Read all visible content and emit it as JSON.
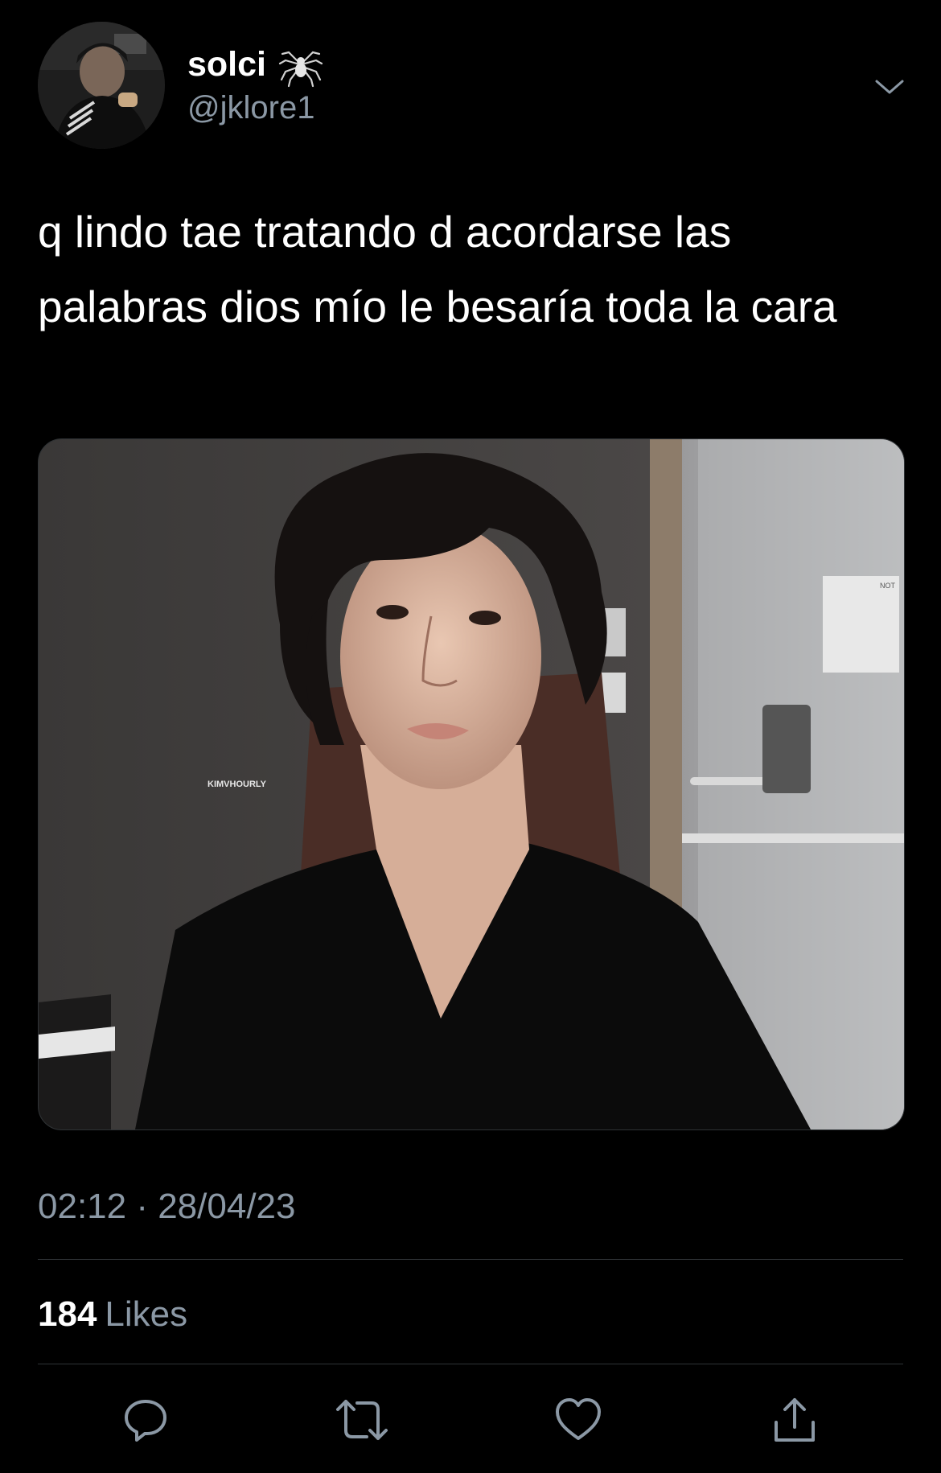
{
  "author": {
    "display_name": "solci",
    "handle": "@jklore1",
    "name_emoji_icon": "spider-icon"
  },
  "tweet": {
    "text": "q lindo tae tratando d acordarse las palabras dios mío le besaría toda la cara",
    "media_watermark": "KIMVHOURLY",
    "media_sign_text": "NOT"
  },
  "meta": {
    "timestamp": "02:12 · 28/04/23"
  },
  "stats": {
    "likes_count": "184",
    "likes_label": "Likes"
  },
  "actions": [
    {
      "name": "reply",
      "icon": "reply-icon"
    },
    {
      "name": "retweet",
      "icon": "retweet-icon"
    },
    {
      "name": "like",
      "icon": "heart-icon"
    },
    {
      "name": "share",
      "icon": "share-icon"
    }
  ],
  "colors": {
    "background": "#000000",
    "primary_text": "#ffffff",
    "secondary_text": "#8b98a5",
    "divider": "#2f3336"
  }
}
